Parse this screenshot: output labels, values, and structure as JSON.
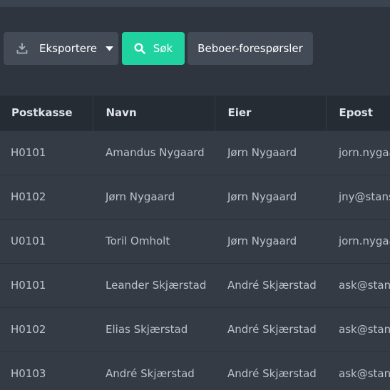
{
  "toolbar": {
    "export_label": "Eksportere",
    "search_label": "Søk",
    "requests_label": "Beboer-forespørsler"
  },
  "icons": {
    "export": "download-icon",
    "caret": "caret-down-icon",
    "search": "search-icon"
  },
  "colors": {
    "accent": "#1fd2a0",
    "background": "#343b45",
    "header_bg": "#262c34",
    "button_bg": "#434b56"
  },
  "table": {
    "columns": [
      "Postkasse",
      "Navn",
      "Eier",
      "Epost"
    ],
    "rows": [
      [
        "H0101",
        "Amandus Nygaard",
        "Jørn Nygaard",
        "jorn.nygaard"
      ],
      [
        "H0102",
        "Jørn Nygaard",
        "Jørn Nygaard",
        "jny@stansberg"
      ],
      [
        "U0101",
        "Toril Omholt",
        "Jørn Nygaard",
        "jorn.nygaard"
      ],
      [
        "H0101",
        "Leander Skjærstad",
        "André Skjærstad",
        "ask@stansberg"
      ],
      [
        "H0102",
        "Elias Skjærstad",
        "André Skjærstad",
        "ask@stansberg"
      ],
      [
        "H0103",
        "André Skjærstad",
        "André Skjærstad",
        "ask@stansberg"
      ]
    ]
  }
}
